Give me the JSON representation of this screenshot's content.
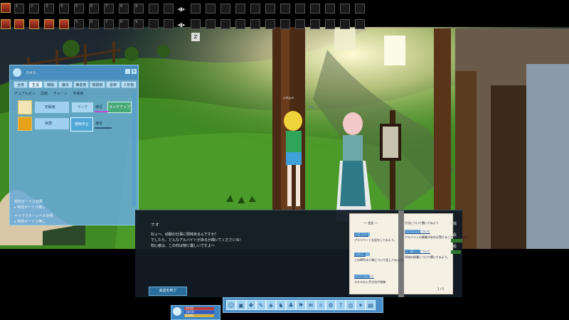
{
  "hotbar": {
    "row1_numbers": [
      "1",
      "2",
      "3",
      "4",
      "5",
      "6",
      "7",
      "8",
      "9"
    ],
    "row2_numbers": [
      "1",
      "2",
      "3",
      "4",
      "5",
      "6",
      "7",
      "8",
      "9"
    ],
    "swap_label_top": "◂▮▸",
    "swap_label_bottom": "◂▮▸",
    "key_indicator": "Z"
  },
  "skill_window": {
    "title": "スキル",
    "tabs": [
      "全体",
      "生活",
      "戦闘",
      "魔法",
      "錬金術",
      "格闘術",
      "音楽",
      "人形術"
    ],
    "subtabs": [
      "デュアルガン",
      "忍術",
      "チェーン",
      "手裏剣"
    ],
    "skills": [
      {
        "name": "初級者",
        "rank": "ランク",
        "training": "練習",
        "icon": "skill-icon-novice"
      },
      {
        "name": "休憩",
        "status": "使用中止",
        "training": "練習",
        "icon": "skill-icon-rest"
      }
    ],
    "advance_button": "ランクアップ",
    "footer_label_1": "特技ボーナス効果",
    "footer_value_1": "▸ 特技ボーナス無し",
    "footer_label_2": "キャラクターレベル効果",
    "footer_value_2": "▸ 特技ボーナス無し"
  },
  "npc": {
    "name_tag": "ナオ"
  },
  "player": {
    "name_tag": "cottype"
  },
  "dialog": {
    "speaker": "ナオ",
    "lines": [
      "ねぇ〜、幼馴の仕事に興味あるんですか？",
      "でしたら、どんなアルバイトがあるか聞いてくださいね！",
      "初心者は、この村は特に優しいですよ〜"
    ],
    "end_button": "会話を終了"
  },
  "book": {
    "left_title": "── 会話 ──",
    "left_links": [
      {
        "label": "個人的な話",
        "desc": "プライベートな話をしてみよう。"
      },
      {
        "label": "近くの噂",
        "desc": "このNPCの人物について話してみよう。"
      },
      {
        "label": "スキルについて",
        "desc": "スキルの入手方法や修練"
      }
    ],
    "right_heading": "方法について聞いてみよう",
    "right_links": [
      {
        "label": "アルバイトについて",
        "desc": "アルバイトの募集があれば受けることができます。"
      },
      {
        "label": "授業・訓練について",
        "desc": "学校の授業について聞いてみよう。"
      }
    ],
    "page_indicator": "1 / 5"
  },
  "side_panel": {
    "labels": [
      "基礎",
      "中級",
      "上級"
    ]
  },
  "status_panel": {
    "hp": "65/65",
    "mp": "10/10",
    "sp": "63/63"
  },
  "toolbar": {
    "buttons": [
      "character",
      "inventory",
      "skill",
      "quest",
      "map",
      "pet",
      "party",
      "guild",
      "chat",
      "community",
      "options",
      "help",
      "camera",
      "mail",
      "book",
      "system"
    ]
  },
  "colors": {
    "window_blue": "#69aad7",
    "toolbar_blue": "#4a8fc8",
    "dialog_bg": "#121a24",
    "grass": "#3b7a1e"
  }
}
